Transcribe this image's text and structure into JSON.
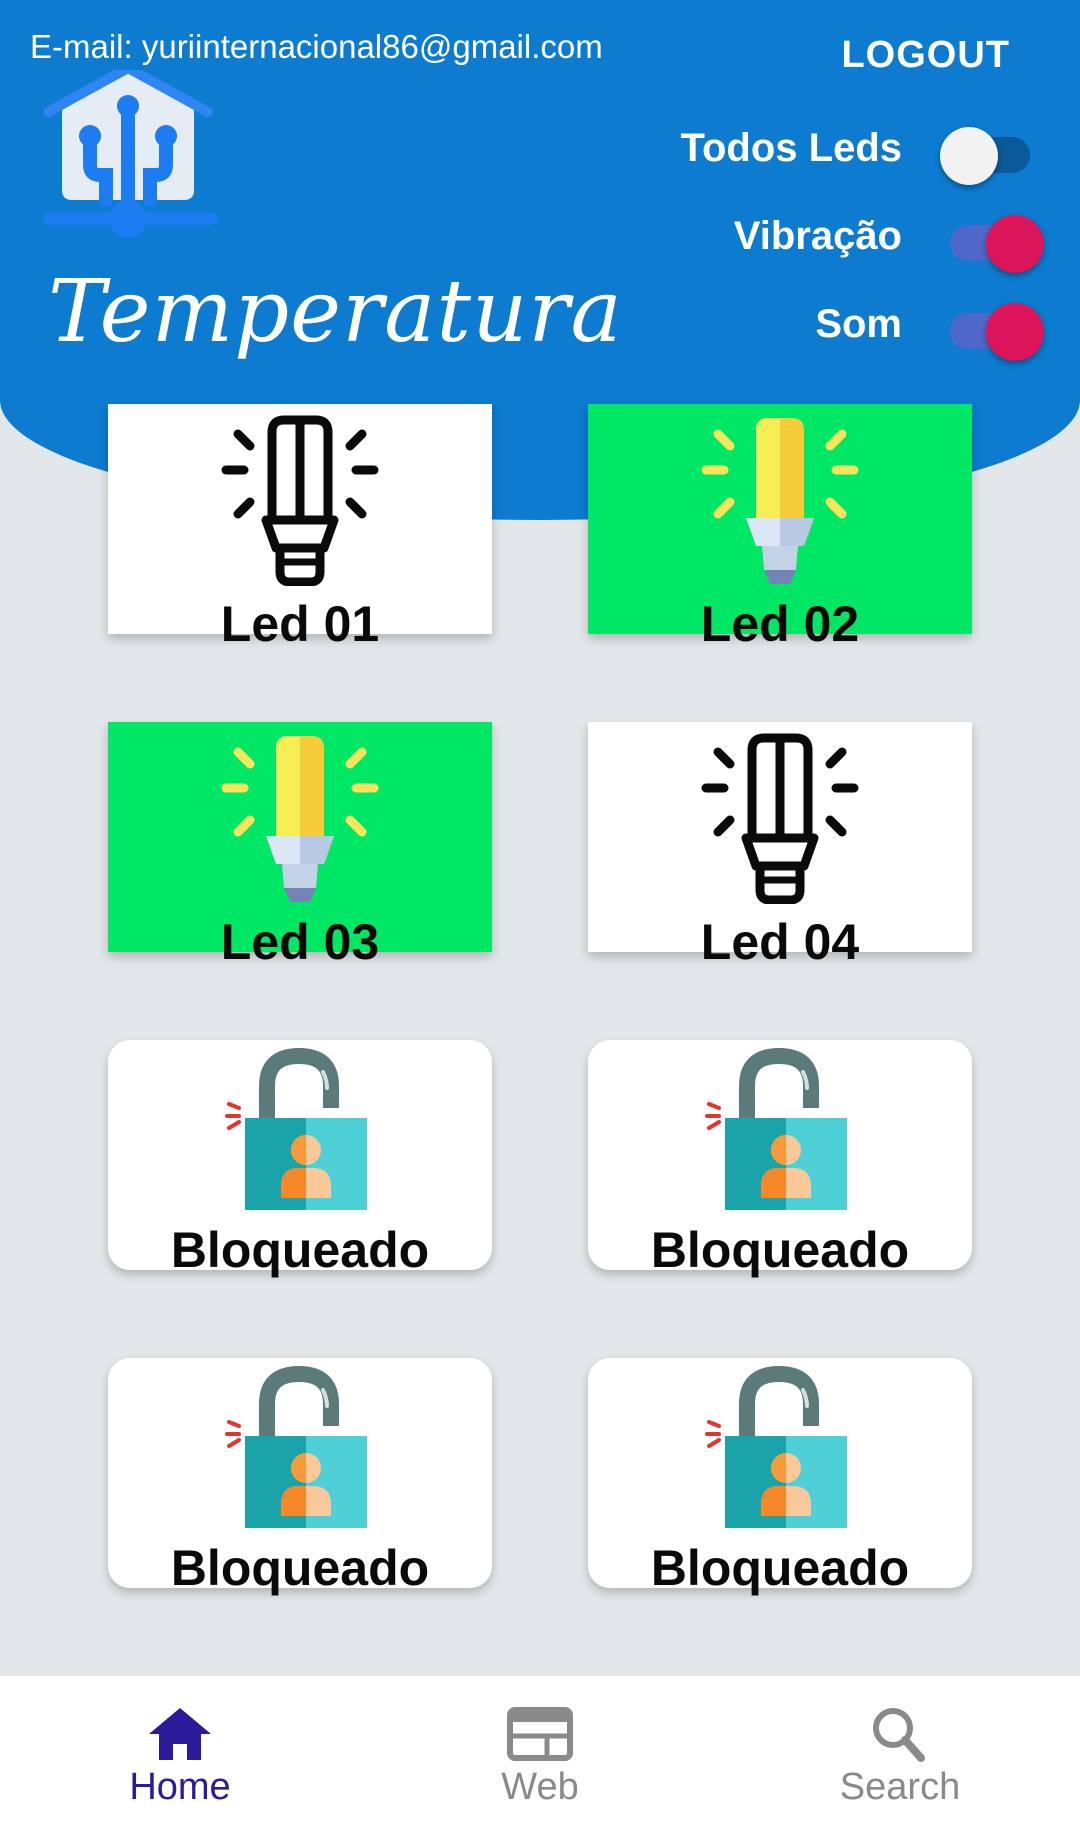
{
  "header": {
    "email": "E-mail: yuriinternacional86@gmail.com",
    "logout": "LOGOUT",
    "title": "Temperatura",
    "toggles": [
      {
        "label": "Todos Leds",
        "on": false
      },
      {
        "label": "Vibração",
        "on": true
      },
      {
        "label": "Som",
        "on": true
      }
    ]
  },
  "cards": [
    {
      "label": "Led 01",
      "type": "bulb",
      "on": false
    },
    {
      "label": "Led 02",
      "type": "bulb",
      "on": true
    },
    {
      "label": "Led 03",
      "type": "bulb",
      "on": true
    },
    {
      "label": "Led 04",
      "type": "bulb",
      "on": false
    },
    {
      "label": "Bloqueado",
      "type": "lock"
    },
    {
      "label": "Bloqueado",
      "type": "lock"
    },
    {
      "label": "Bloqueado",
      "type": "lock"
    },
    {
      "label": "Bloqueado",
      "type": "lock"
    }
  ],
  "nav": {
    "items": [
      {
        "label": "Home",
        "icon": "home-icon",
        "active": true
      },
      {
        "label": "Web",
        "icon": "web-icon",
        "active": false
      },
      {
        "label": "Search",
        "icon": "search-icon",
        "active": false
      }
    ]
  },
  "colors": {
    "header": "#0c7bd0",
    "card_on": "#00e765",
    "toggle_thumb_on": "#dc145a",
    "nav_active": "#2b1a9a"
  }
}
